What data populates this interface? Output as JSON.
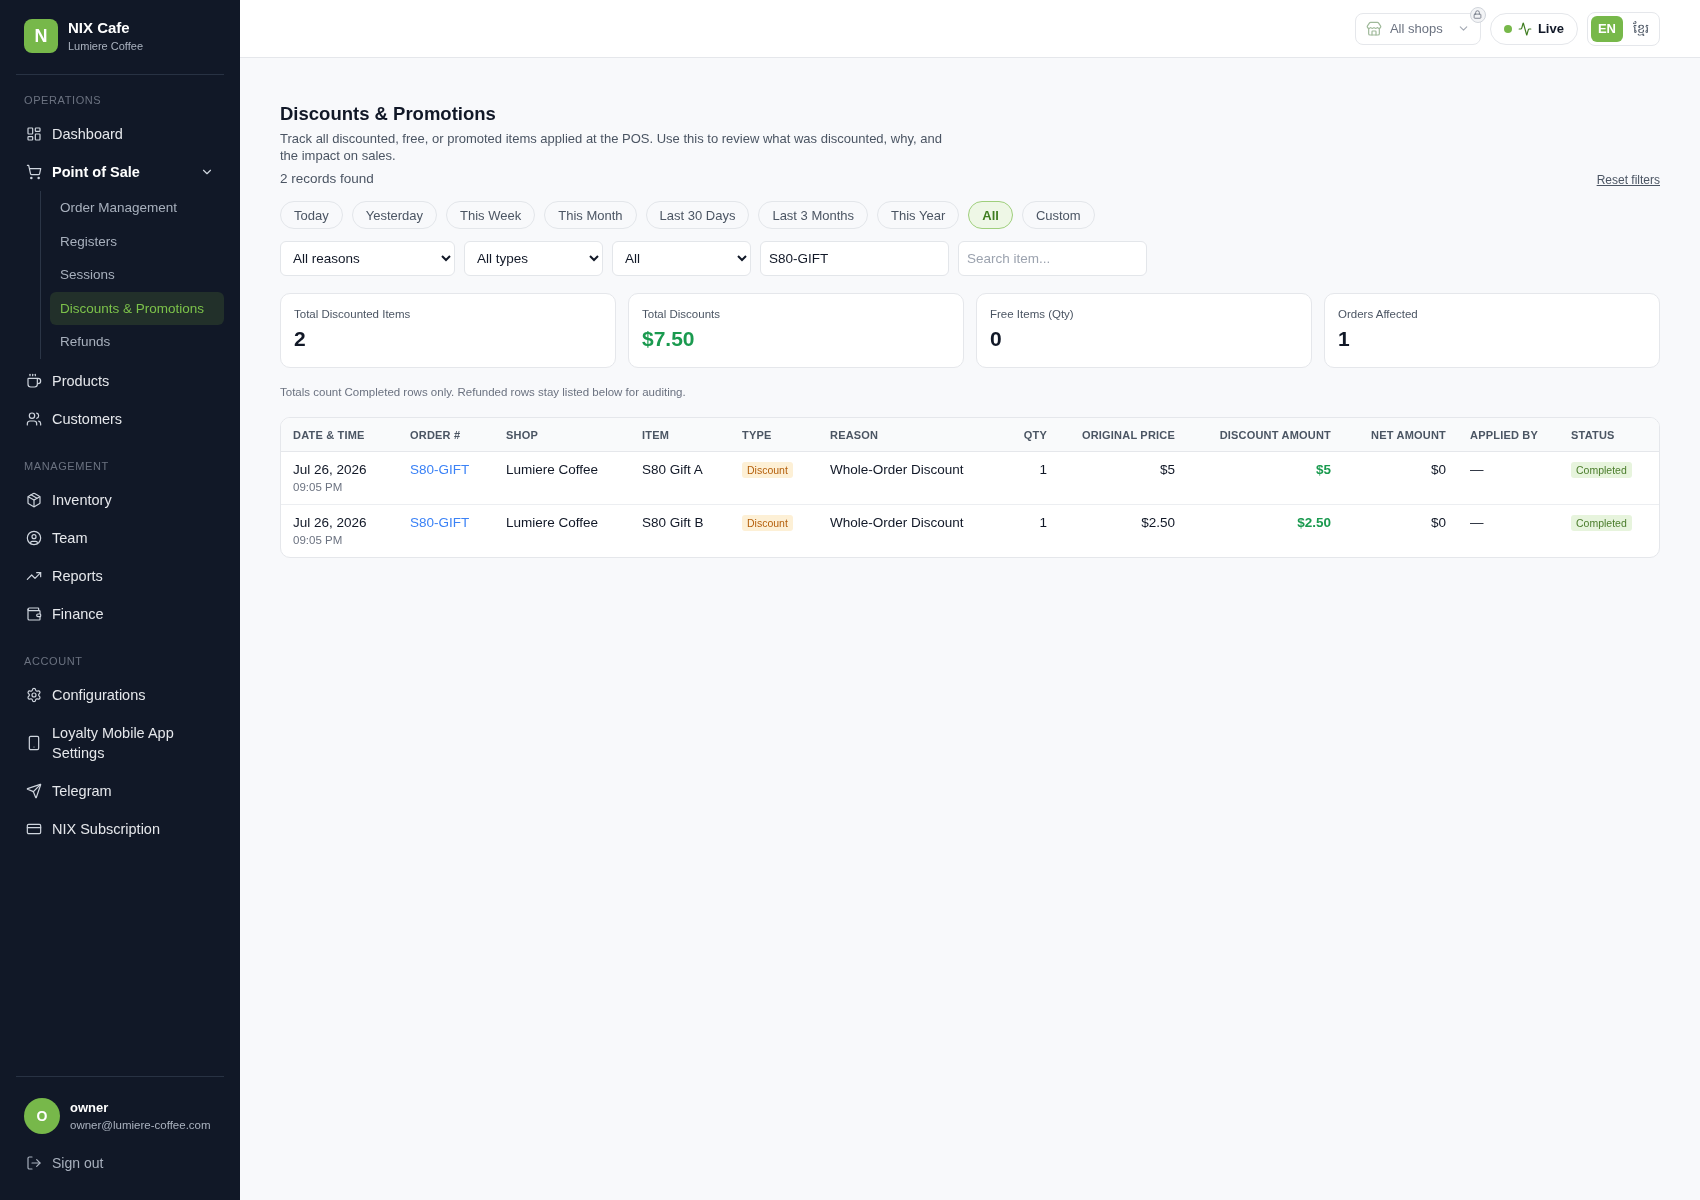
{
  "sidebar": {
    "brand": {
      "logo_letter": "N",
      "name": "NIX Cafe",
      "subtitle": "Lumiere Coffee"
    },
    "sections": [
      {
        "heading": "OPERATIONS",
        "items": [
          {
            "label": "Dashboard",
            "selected": false
          },
          {
            "label": "Point of Sale",
            "selected": false,
            "expanded": true,
            "children": [
              {
                "label": "Order Management",
                "selected": false
              },
              {
                "label": "Registers",
                "selected": false
              },
              {
                "label": "Sessions",
                "selected": false
              },
              {
                "label": "Discounts & Promotions",
                "selected": true
              },
              {
                "label": "Refunds",
                "selected": false
              }
            ]
          },
          {
            "label": "Products",
            "selected": false
          },
          {
            "label": "Customers",
            "selected": false
          }
        ]
      },
      {
        "heading": "MANAGEMENT",
        "items": [
          {
            "label": "Inventory",
            "selected": false
          },
          {
            "label": "Team",
            "selected": false
          },
          {
            "label": "Reports",
            "selected": false
          },
          {
            "label": "Finance",
            "selected": false
          }
        ]
      },
      {
        "heading": "ACCOUNT",
        "items": [
          {
            "label": "Configurations",
            "selected": false
          },
          {
            "label": "Loyalty Mobile App Settings",
            "selected": false
          },
          {
            "label": "Telegram",
            "selected": false
          },
          {
            "label": "NIX Subscription",
            "selected": false
          }
        ]
      }
    ],
    "user": {
      "avatar_letter": "O",
      "name": "owner",
      "email": "owner@lumiere-coffee.com"
    },
    "sign_out": "Sign out"
  },
  "top_bar": {
    "shop_select": {
      "value": "All shops",
      "locked": true
    },
    "live": {
      "label": "Live",
      "on": true
    },
    "languages": [
      {
        "label": "EN",
        "selected": true
      },
      {
        "label": "ខ្មែរ",
        "selected": false
      }
    ]
  },
  "page": {
    "title": "Discounts & Promotions",
    "description": "Track all discounted, free, or promoted items applied at the POS. Use this to review what was discounted, why, and the impact on sales.",
    "record_count": "2 records found",
    "reset_link": "Reset filters"
  },
  "date_ranges": [
    {
      "label": "Today",
      "selected": false
    },
    {
      "label": "Yesterday",
      "selected": false
    },
    {
      "label": "This Week",
      "selected": false
    },
    {
      "label": "This Month",
      "selected": false
    },
    {
      "label": "Last 30 Days",
      "selected": false
    },
    {
      "label": "Last 3 Months",
      "selected": false
    },
    {
      "label": "This Year",
      "selected": false
    },
    {
      "label": "All",
      "selected": true
    },
    {
      "label": "Custom",
      "selected": false
    }
  ],
  "filters": [
    {
      "kind": "select",
      "value": "All reasons"
    },
    {
      "kind": "select",
      "value": "All types"
    },
    {
      "kind": "select",
      "value": "All"
    },
    {
      "kind": "text",
      "value": "S80-GIFT"
    },
    {
      "kind": "text",
      "placeholder": "Search item..."
    }
  ],
  "stats": [
    {
      "label": "Total Discounted Items",
      "value": "2",
      "highlighted": false
    },
    {
      "label": "Total Discounts",
      "value": "$7.50",
      "highlighted": true
    },
    {
      "label": "Free Items (Qty)",
      "value": "0",
      "highlighted": false
    },
    {
      "label": "Orders Affected",
      "value": "1",
      "highlighted": false
    }
  ],
  "note": "Totals count Completed rows only. Refunded rows stay listed below for auditing.",
  "table": {
    "columns": [
      "DATE & TIME",
      "ORDER #",
      "SHOP",
      "ITEM",
      "TYPE",
      "REASON",
      "QTY",
      "ORIGINAL PRICE",
      "DISCOUNT AMOUNT",
      "NET AMOUNT",
      "APPLIED BY",
      "STATUS"
    ],
    "rows": [
      {
        "date": "Jul 26, 2026",
        "time": "09:05 PM",
        "order": "S80-GIFT",
        "shop": "Lumiere Coffee",
        "item": "S80 Gift A",
        "type": "Discount",
        "reason": "Whole-Order Discount",
        "qty": "1",
        "original_price": "$5",
        "discount_amount": "$5",
        "net_amount": "$0",
        "applied_by": "—",
        "status": "Completed"
      },
      {
        "date": "Jul 26, 2026",
        "time": "09:05 PM",
        "order": "S80-GIFT",
        "shop": "Lumiere Coffee",
        "item": "S80 Gift B",
        "type": "Discount",
        "reason": "Whole-Order Discount",
        "qty": "1",
        "original_price": "$2.50",
        "discount_amount": "$2.50",
        "net_amount": "$0",
        "applied_by": "—",
        "status": "Completed"
      }
    ]
  }
}
